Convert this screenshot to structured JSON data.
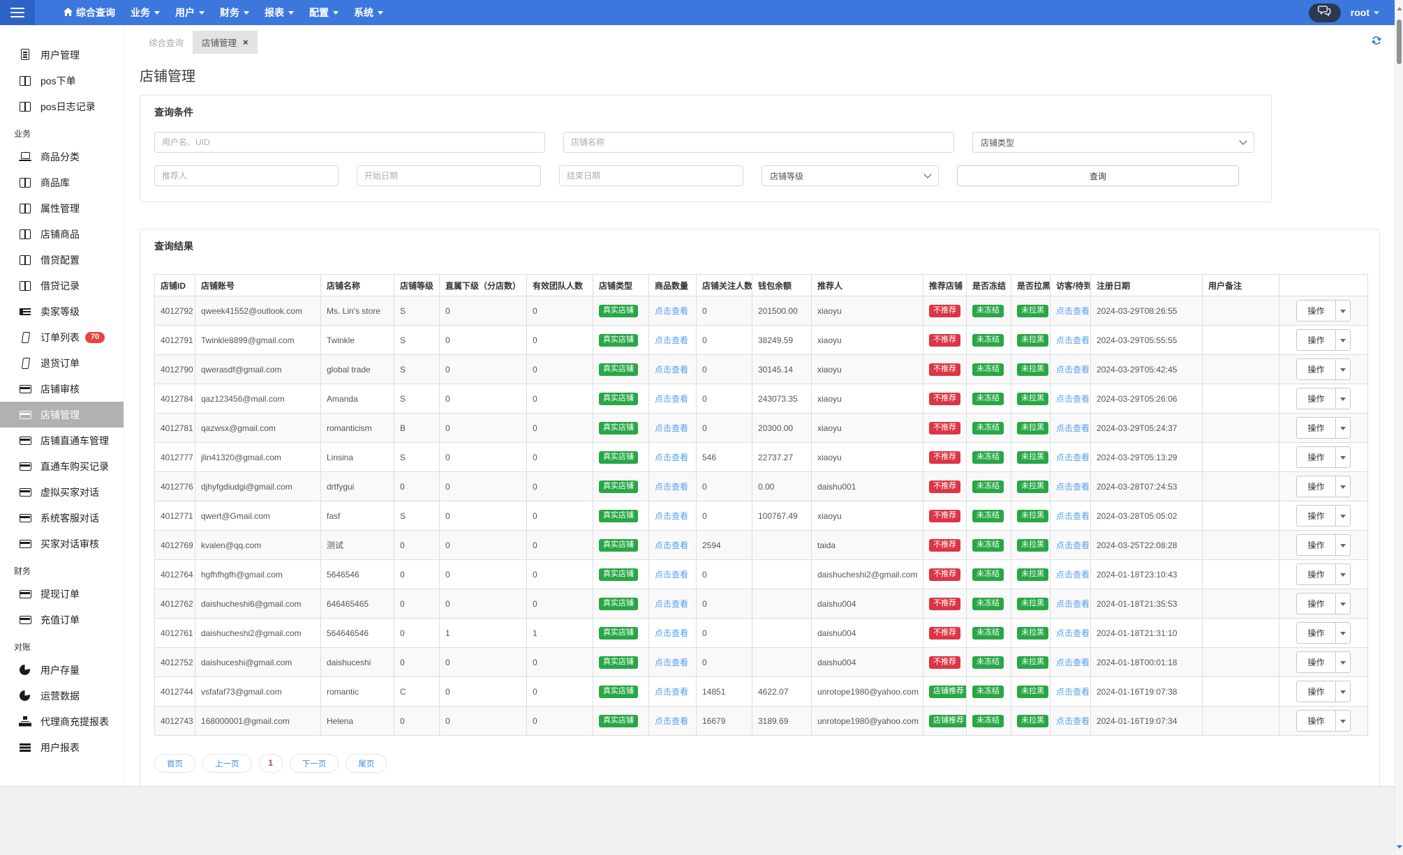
{
  "navbar": {
    "user": "root",
    "menu": [
      {
        "key": "overview",
        "label": "综合查询",
        "home_icon": true,
        "caret": false
      },
      {
        "key": "business",
        "label": "业务",
        "caret": true
      },
      {
        "key": "user",
        "label": "用户",
        "caret": true
      },
      {
        "key": "finance",
        "label": "财务",
        "caret": true
      },
      {
        "key": "report",
        "label": "报表",
        "caret": true
      },
      {
        "key": "config",
        "label": "配置",
        "caret": true
      },
      {
        "key": "system",
        "label": "系统",
        "caret": true
      }
    ]
  },
  "sidebar": {
    "items": [
      {
        "type": "item",
        "key": "user-management",
        "label": "用户管理",
        "icon": "document-icon"
      },
      {
        "type": "item",
        "key": "pos-order",
        "label": "pos下单",
        "icon": "table-icon"
      },
      {
        "type": "item",
        "key": "pos-log",
        "label": "pos日志记录",
        "icon": "table-icon"
      },
      {
        "type": "header",
        "key": "section-business",
        "label": "业务"
      },
      {
        "type": "item",
        "key": "goods-category",
        "label": "商品分类",
        "icon": "laptop-icon"
      },
      {
        "type": "item",
        "key": "goods-library",
        "label": "商品库",
        "icon": "table-icon"
      },
      {
        "type": "item",
        "key": "attribute-management",
        "label": "属性管理",
        "icon": "table-icon"
      },
      {
        "type": "item",
        "key": "shop-goods",
        "label": "店铺商品",
        "icon": "table-icon"
      },
      {
        "type": "item",
        "key": "loan-config",
        "label": "借贷配置",
        "icon": "table-icon"
      },
      {
        "type": "item",
        "key": "loan-records",
        "label": "借贷记录",
        "icon": "table-icon"
      },
      {
        "type": "item",
        "key": "seller-level",
        "label": "卖家等级",
        "icon": "indent-icon"
      },
      {
        "type": "item",
        "key": "order-list",
        "label": "订单列表",
        "icon": "phone-icon",
        "badge": "70"
      },
      {
        "type": "item",
        "key": "return-orders",
        "label": "退货订单",
        "icon": "phone-icon"
      },
      {
        "type": "item",
        "key": "shop-review",
        "label": "店铺审核",
        "icon": "card-icon"
      },
      {
        "type": "item",
        "key": "shop-management",
        "label": "店铺管理",
        "icon": "card-icon",
        "active": true
      },
      {
        "type": "item",
        "key": "shop-through-train",
        "label": "店铺直通车管理",
        "icon": "card-icon"
      },
      {
        "type": "item",
        "key": "through-train-purchases",
        "label": "直通车购买记录",
        "icon": "card-icon"
      },
      {
        "type": "item",
        "key": "virtual-buyer-chat",
        "label": "虚拟买家对话",
        "icon": "card-icon"
      },
      {
        "type": "item",
        "key": "system-service-chat",
        "label": "系统客服对话",
        "icon": "card-icon"
      },
      {
        "type": "item",
        "key": "buyer-chat-review",
        "label": "买家对话审核",
        "icon": "card-icon"
      },
      {
        "type": "header",
        "key": "section-finance",
        "label": "财务"
      },
      {
        "type": "item",
        "key": "withdraw-orders",
        "label": "提现订单",
        "icon": "card-icon"
      },
      {
        "type": "item",
        "key": "recharge-orders",
        "label": "充值订单",
        "icon": "card-icon"
      },
      {
        "type": "header",
        "key": "section-reconciliation",
        "label": "对账"
      },
      {
        "type": "item",
        "key": "user-stock",
        "label": "用户存量",
        "icon": "pie-icon"
      },
      {
        "type": "item",
        "key": "operation-data",
        "label": "运营数据",
        "icon": "pie-icon"
      },
      {
        "type": "item",
        "key": "agent-recharge-report",
        "label": "代理商充提报表",
        "icon": "sitemap-icon"
      },
      {
        "type": "item",
        "key": "user-report",
        "label": "用户报表",
        "icon": "bars-icon"
      }
    ]
  },
  "tabs": [
    {
      "key": "overview",
      "label": "综合查询",
      "active": false
    },
    {
      "key": "shop-management",
      "label": "店铺管理",
      "active": true,
      "close_glyph": "×"
    }
  ],
  "page": {
    "title": "店铺管理"
  },
  "query": {
    "panel_title": "查询条件",
    "fields": {
      "username_uid": "用户名、UID",
      "shop_name": "店铺名称",
      "referrer": "推荐人",
      "start_date": "开始日期",
      "end_date": "结束日期"
    },
    "selects": {
      "shop_type": "店铺类型",
      "shop_level": "店铺等级"
    },
    "submit": "查询"
  },
  "results": {
    "panel_title": "查询结果",
    "action_label": "操作",
    "columns": [
      {
        "key": "shop-id",
        "label": "店铺ID"
      },
      {
        "key": "account",
        "label": "店铺账号"
      },
      {
        "key": "shop-name",
        "label": "店铺名称"
      },
      {
        "key": "level",
        "label": "店铺等级"
      },
      {
        "key": "direct-subs",
        "label": "直属下级（分店数）"
      },
      {
        "key": "team-count",
        "label": "有效团队人数"
      },
      {
        "key": "shop-type",
        "label": "店铺类型"
      },
      {
        "key": "goods-count",
        "label": "商品数量"
      },
      {
        "key": "followers",
        "label": "店铺关注人数"
      },
      {
        "key": "wallet",
        "label": "钱包余额"
      },
      {
        "key": "referrer",
        "label": "推荐人"
      },
      {
        "key": "recommend",
        "label": "推荐店铺"
      },
      {
        "key": "frozen",
        "label": "是否冻结"
      },
      {
        "key": "blacklist",
        "label": "是否拉黑"
      },
      {
        "key": "visitor",
        "label": "访客/待到账"
      },
      {
        "key": "reg-date",
        "label": "注册日期"
      },
      {
        "key": "remark",
        "label": "用户备注"
      },
      {
        "key": "actions",
        "label": ""
      }
    ],
    "rows": [
      {
        "id": "4012792",
        "account": "qweek41552@outlook.com",
        "name": "Ms. Lin's store",
        "level": "S",
        "subs": "0",
        "team": "0",
        "type": "真实店铺",
        "goods": "点击查看",
        "followers": "0",
        "wallet": "201500.00",
        "referrer": "xiaoyu",
        "recommend": "不推荐",
        "recommend_variant": "danger",
        "frozen": "未冻结",
        "blacklist": "未拉黑",
        "visitor": "点击查看",
        "registered": "2024-03-29T08:26:55",
        "remark": ""
      },
      {
        "id": "4012791",
        "account": "Twinkle8899@gmail.com",
        "name": "Twinkle",
        "level": "S",
        "subs": "0",
        "team": "0",
        "type": "真实店铺",
        "goods": "点击查看",
        "followers": "0",
        "wallet": "38249.59",
        "referrer": "xiaoyu",
        "recommend": "不推荐",
        "recommend_variant": "danger",
        "frozen": "未冻结",
        "blacklist": "未拉黑",
        "visitor": "点击查看",
        "registered": "2024-03-29T05:55:55",
        "remark": ""
      },
      {
        "id": "4012790",
        "account": "qwerasdf@gmail.com",
        "name": "global trade",
        "level": "S",
        "subs": "0",
        "team": "0",
        "type": "真实店铺",
        "goods": "点击查看",
        "followers": "0",
        "wallet": "30145.14",
        "referrer": "xiaoyu",
        "recommend": "不推荐",
        "recommend_variant": "danger",
        "frozen": "未冻结",
        "blacklist": "未拉黑",
        "visitor": "点击查看",
        "registered": "2024-03-29T05:42:45",
        "remark": ""
      },
      {
        "id": "4012784",
        "account": "qaz123456@mail.com",
        "name": "Amanda",
        "level": "S",
        "subs": "0",
        "team": "0",
        "type": "真实店铺",
        "goods": "点击查看",
        "followers": "0",
        "wallet": "243073.35",
        "referrer": "xiaoyu",
        "recommend": "不推荐",
        "recommend_variant": "danger",
        "frozen": "未冻结",
        "blacklist": "未拉黑",
        "visitor": "点击查看",
        "registered": "2024-03-29T05:26:06",
        "remark": ""
      },
      {
        "id": "4012781",
        "account": "qazwsx@gmail.com",
        "name": "romanticism",
        "level": "B",
        "subs": "0",
        "team": "0",
        "type": "真实店铺",
        "goods": "点击查看",
        "followers": "0",
        "wallet": "20300.00",
        "referrer": "xiaoyu",
        "recommend": "不推荐",
        "recommend_variant": "danger",
        "frozen": "未冻结",
        "blacklist": "未拉黑",
        "visitor": "点击查看",
        "registered": "2024-03-29T05:24:37",
        "remark": ""
      },
      {
        "id": "4012777",
        "account": "jlin41320@gmail.com",
        "name": "Linsina",
        "level": "S",
        "subs": "0",
        "team": "0",
        "type": "真实店铺",
        "goods": "点击查看",
        "followers": "546",
        "wallet": "22737.27",
        "referrer": "xiaoyu",
        "recommend": "不推荐",
        "recommend_variant": "danger",
        "frozen": "未冻结",
        "blacklist": "未拉黑",
        "visitor": "点击查看",
        "registered": "2024-03-29T05:13:29",
        "remark": ""
      },
      {
        "id": "4012776",
        "account": "djhyfgdiudgi@gmail.com",
        "name": "drtfygui",
        "level": "0",
        "subs": "0",
        "team": "0",
        "type": "真实店铺",
        "goods": "点击查看",
        "followers": "0",
        "wallet": "0.00",
        "referrer": "daishu001",
        "recommend": "不推荐",
        "recommend_variant": "danger",
        "frozen": "未冻结",
        "blacklist": "未拉黑",
        "visitor": "点击查看",
        "registered": "2024-03-28T07:24:53",
        "remark": ""
      },
      {
        "id": "4012771",
        "account": "qwert@Gmail.com",
        "name": "fasf",
        "level": "S",
        "subs": "0",
        "team": "0",
        "type": "真实店铺",
        "goods": "点击查看",
        "followers": "0",
        "wallet": "100767.49",
        "referrer": "xiaoyu",
        "recommend": "不推荐",
        "recommend_variant": "danger",
        "frozen": "未冻结",
        "blacklist": "未拉黑",
        "visitor": "点击查看",
        "registered": "2024-03-28T05:05:02",
        "remark": ""
      },
      {
        "id": "4012769",
        "account": "kvalen@qq.com",
        "name": "测试",
        "level": "0",
        "subs": "0",
        "team": "0",
        "type": "真实店铺",
        "goods": "点击查看",
        "followers": "2594",
        "wallet": "",
        "referrer": "taida",
        "recommend": "不推荐",
        "recommend_variant": "danger",
        "frozen": "未冻结",
        "blacklist": "未拉黑",
        "visitor": "点击查看",
        "registered": "2024-03-25T22:08:28",
        "remark": ""
      },
      {
        "id": "4012764",
        "account": "hgfhfhgfh@gmail.com",
        "name": "5646546",
        "level": "0",
        "subs": "0",
        "team": "0",
        "type": "真实店铺",
        "goods": "点击查看",
        "followers": "0",
        "wallet": "",
        "referrer": "daishucheshi2@gmail.com",
        "recommend": "不推荐",
        "recommend_variant": "danger",
        "frozen": "未冻结",
        "blacklist": "未拉黑",
        "visitor": "点击查看",
        "registered": "2024-01-18T23:10:43",
        "remark": ""
      },
      {
        "id": "4012762",
        "account": "daishucheshi6@gmail.com",
        "name": "646465465",
        "level": "0",
        "subs": "0",
        "team": "0",
        "type": "真实店铺",
        "goods": "点击查看",
        "followers": "0",
        "wallet": "",
        "referrer": "daishu004",
        "recommend": "不推荐",
        "recommend_variant": "danger",
        "frozen": "未冻结",
        "blacklist": "未拉黑",
        "visitor": "点击查看",
        "registered": "2024-01-18T21:35:53",
        "remark": ""
      },
      {
        "id": "4012761",
        "account": "daishucheshi2@gmail.com",
        "name": "564646546",
        "level": "0",
        "subs": "1",
        "team": "1",
        "type": "真实店铺",
        "goods": "点击查看",
        "followers": "0",
        "wallet": "",
        "referrer": "daishu004",
        "recommend": "不推荐",
        "recommend_variant": "danger",
        "frozen": "未冻结",
        "blacklist": "未拉黑",
        "visitor": "点击查看",
        "registered": "2024-01-18T21:31:10",
        "remark": ""
      },
      {
        "id": "4012752",
        "account": "daishuceshi@gmail.com",
        "name": "daishuceshi",
        "level": "0",
        "subs": "0",
        "team": "0",
        "type": "真实店铺",
        "goods": "点击查看",
        "followers": "0",
        "wallet": "",
        "referrer": "daishu004",
        "recommend": "不推荐",
        "recommend_variant": "danger",
        "frozen": "未冻结",
        "blacklist": "未拉黑",
        "visitor": "点击查看",
        "registered": "2024-01-18T00:01:18",
        "remark": ""
      },
      {
        "id": "4012744",
        "account": "vsfafaf73@gmail.com",
        "name": "romantic",
        "level": "C",
        "subs": "0",
        "team": "0",
        "type": "真实店铺",
        "goods": "点击查看",
        "followers": "14851",
        "wallet": "4622.07",
        "referrer": "unrotope1980@yahoo.com",
        "recommend": "店铺推荐",
        "recommend_variant": "success",
        "frozen": "未冻结",
        "blacklist": "未拉黑",
        "visitor": "点击查看",
        "registered": "2024-01-16T19:07:38",
        "remark": ""
      },
      {
        "id": "4012743",
        "account": "168000001@gmail.com",
        "name": "Helena",
        "level": "0",
        "subs": "0",
        "team": "0",
        "type": "真实店铺",
        "goods": "点击查看",
        "followers": "16679",
        "wallet": "3189.69",
        "referrer": "unrotope1980@yahoo.com",
        "recommend": "店铺推荐",
        "recommend_variant": "success",
        "frozen": "未冻结",
        "blacklist": "未拉黑",
        "visitor": "点击查看",
        "registered": "2024-01-16T19:07:34",
        "remark": ""
      }
    ]
  },
  "pagination": [
    {
      "key": "first",
      "label": "首页"
    },
    {
      "key": "prev",
      "label": "上一页"
    },
    {
      "key": "page-1",
      "label": "1",
      "current": true
    },
    {
      "key": "next",
      "label": "下一页"
    },
    {
      "key": "last",
      "label": "尾页"
    }
  ],
  "colors": {
    "navbar_blue": "#3c77dd",
    "hamburger_blue": "#2d63c5",
    "chat_pill_navy": "#2b3a52",
    "success_green": "#28a745",
    "danger_red": "#dc3545",
    "link_blue": "#55a1f3",
    "pagination_blue": "#3f8df5",
    "current_page_red": "#b5443e",
    "active_sidebar_gray": "#b1b1b1",
    "sidebar_badge_red": "#e8433f"
  }
}
